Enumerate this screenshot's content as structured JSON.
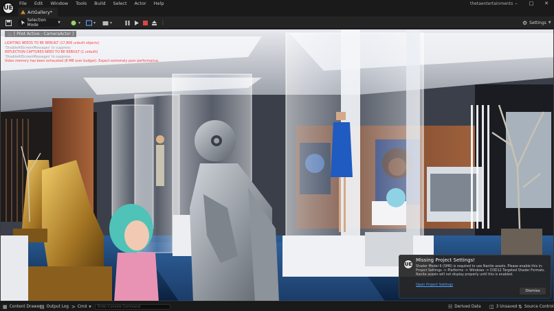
{
  "menubar": {
    "logo": "UE",
    "items": [
      "File",
      "Edit",
      "Window",
      "Tools",
      "Build",
      "Select",
      "Actor",
      "Help"
    ],
    "project": "thetaentertainments",
    "window_icons": {
      "minimize": "minimize-icon",
      "maximize": "maximize-icon",
      "close": "close-icon"
    }
  },
  "tab": {
    "label": "ArtGallery*",
    "icon": "level-icon"
  },
  "toolbar": {
    "selection_mode": "Selection Mode",
    "settings": "Settings",
    "icons": [
      "save-icon",
      "add-actor-icon",
      "blueprint-icon",
      "cinematics-icon",
      "pause-icon",
      "play-icon",
      "stop-icon",
      "eject-icon",
      "more-options-icon"
    ]
  },
  "viewport": {
    "pilot": "[ Pilot Active - CameraActor ]",
    "warnings": [
      {
        "text": "LIGHTING NEEDS TO BE REBUILT (17,806 unbuilt objects)",
        "color": "#ff3b3b"
      },
      {
        "text": "'DisableAllScreenMessages' to suppress",
        "color": "#9a9a9a"
      },
      {
        "text": "REFLECTION CAPTURES NEED TO BE REBUILT (1 unbuilt)",
        "color": "#ff3b3b"
      },
      {
        "text": "'DisableAllScreenMessages' to suppress",
        "color": "#9a9a9a"
      },
      {
        "text": "Video memory has been exhausted (8 MB over budget). Expect extremely poor performance.",
        "color": "#ff3b3b"
      }
    ]
  },
  "notification": {
    "title": "Missing Project Settings!",
    "body": "Shader Model 6 (SM6) is required to use Nanite assets. Please enable this in: Project Settings -> Platforms -> Windows -> D3D12 Targeted Shader Formats. Nanite assets will not display properly until this is enabled.",
    "link": "Open Project Settings",
    "dismiss": "Dismiss"
  },
  "statusbar": {
    "content_drawer": "Content Drawer",
    "output_log": "Output Log",
    "cmd": "Cmd",
    "cmd_placeholder": "Enter Console Command",
    "derived_data": "Derived Data",
    "unsaved": "3 Unsaved",
    "source_control": "Source Control"
  },
  "colors": {
    "accent": "#d08a2c",
    "link": "#4fa3ff",
    "warning": "#ff3b3b"
  }
}
